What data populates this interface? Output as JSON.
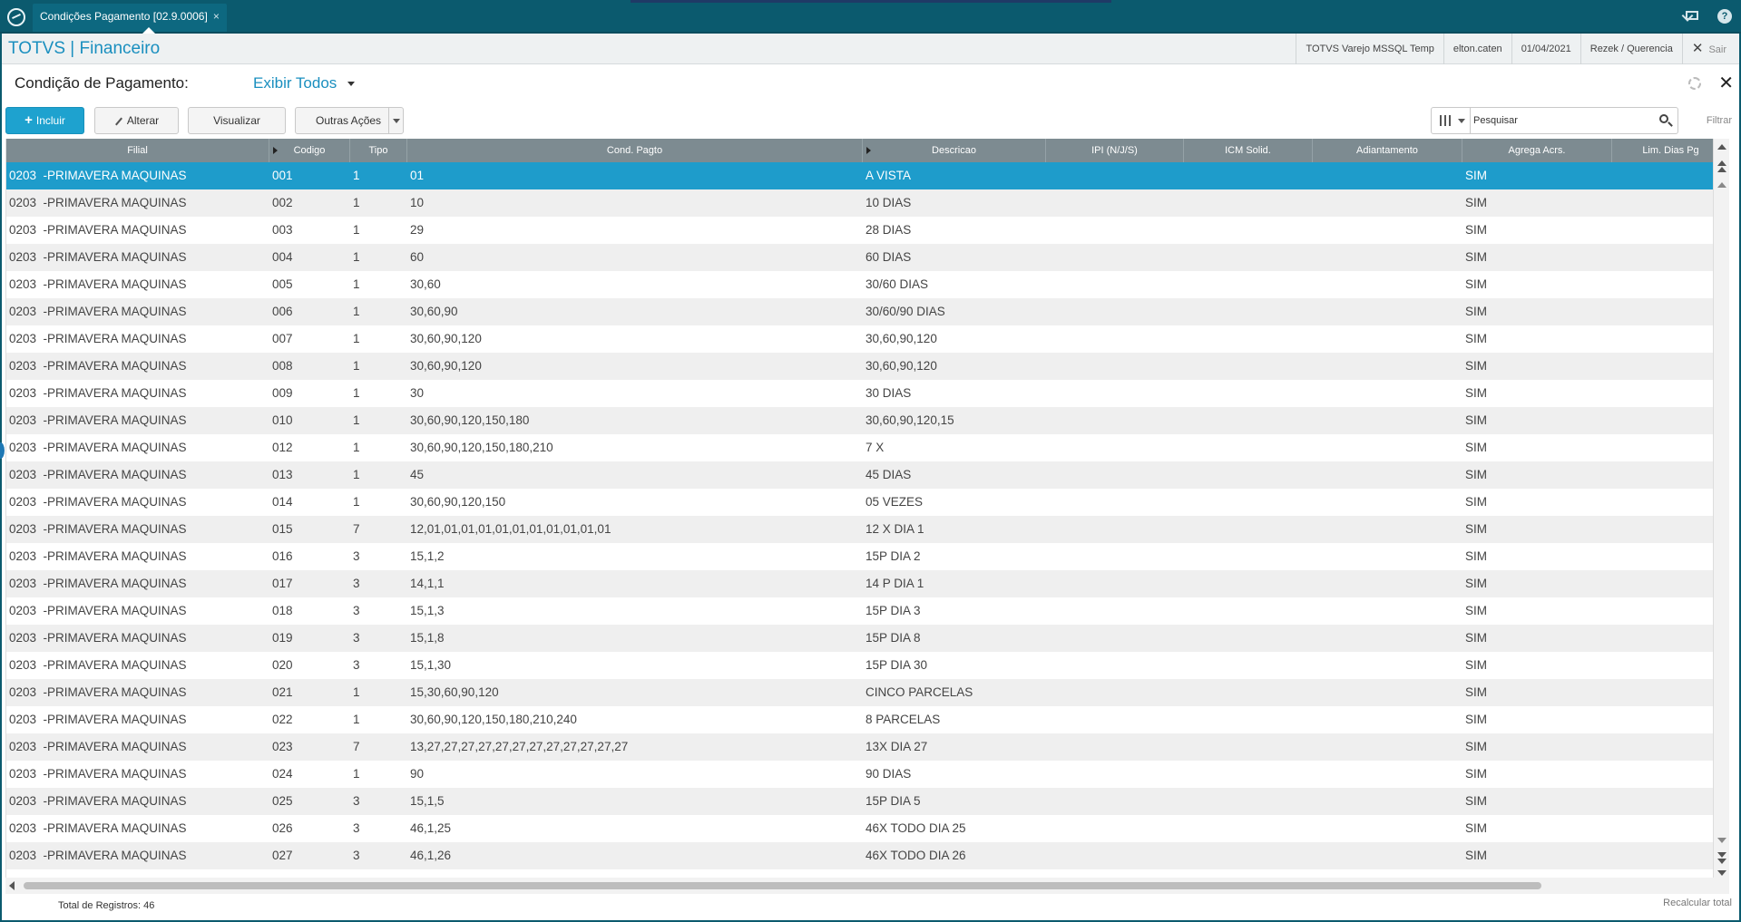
{
  "window": {
    "tab_title": "Condições Pagamento [02.9.0006]",
    "tab_close": "×"
  },
  "module": {
    "title": "TOTVS | Financeiro",
    "environment": "TOTVS Varejo MSSQL Temp",
    "user": "elton.caten",
    "date": "01/04/2021",
    "branch": "Rezek / Querencia",
    "exit_label": "Sair"
  },
  "header": {
    "title": "Condição de Pagamento:",
    "filter_view": "Exibir Todos"
  },
  "toolbar": {
    "include_label": "Incluir",
    "alter_label": "Alterar",
    "view_label": "Visualizar",
    "other_label": "Outras Ações",
    "search_placeholder": "Pesquisar",
    "filter_label": "Filtrar"
  },
  "grid": {
    "columns": [
      "Filial",
      "Codigo",
      "Tipo",
      "Cond. Pagto",
      "Descricao",
      "IPI (N/J/S)",
      "ICM Solid.",
      "Adiantamento",
      "Agrega Acrs.",
      "Lim. Dias Pg"
    ],
    "rows": [
      [
        "0203  -PRIMAVERA MAQUINAS",
        "001",
        "1",
        "01",
        "A VISTA",
        "SIM"
      ],
      [
        "0203  -PRIMAVERA MAQUINAS",
        "002",
        "1",
        "10",
        "10 DIAS",
        "SIM"
      ],
      [
        "0203  -PRIMAVERA MAQUINAS",
        "003",
        "1",
        "29",
        "28 DIAS",
        "SIM"
      ],
      [
        "0203  -PRIMAVERA MAQUINAS",
        "004",
        "1",
        "60",
        "60 DIAS",
        "SIM"
      ],
      [
        "0203  -PRIMAVERA MAQUINAS",
        "005",
        "1",
        "30,60",
        "30/60 DIAS",
        "SIM"
      ],
      [
        "0203  -PRIMAVERA MAQUINAS",
        "006",
        "1",
        "30,60,90",
        "30/60/90 DIAS",
        "SIM"
      ],
      [
        "0203  -PRIMAVERA MAQUINAS",
        "007",
        "1",
        "30,60,90,120",
        "30,60,90,120",
        "SIM"
      ],
      [
        "0203  -PRIMAVERA MAQUINAS",
        "008",
        "1",
        "30,60,90,120",
        "30,60,90,120",
        "SIM"
      ],
      [
        "0203  -PRIMAVERA MAQUINAS",
        "009",
        "1",
        "30",
        "30 DIAS",
        "SIM"
      ],
      [
        "0203  -PRIMAVERA MAQUINAS",
        "010",
        "1",
        "30,60,90,120,150,180",
        "30,60,90,120,15",
        "SIM"
      ],
      [
        "0203  -PRIMAVERA MAQUINAS",
        "012",
        "1",
        "30,60,90,120,150,180,210",
        "7 X",
        "SIM"
      ],
      [
        "0203  -PRIMAVERA MAQUINAS",
        "013",
        "1",
        "45",
        "45 DIAS",
        "SIM"
      ],
      [
        "0203  -PRIMAVERA MAQUINAS",
        "014",
        "1",
        "30,60,90,120,150",
        "05 VEZES",
        "SIM"
      ],
      [
        "0203  -PRIMAVERA MAQUINAS",
        "015",
        "7",
        "12,01,01,01,01,01,01,01,01,01,01,01",
        "12 X DIA 1",
        "SIM"
      ],
      [
        "0203  -PRIMAVERA MAQUINAS",
        "016",
        "3",
        "15,1,2",
        "15P DIA 2",
        "SIM"
      ],
      [
        "0203  -PRIMAVERA MAQUINAS",
        "017",
        "3",
        "14,1,1",
        "14 P DIA 1",
        "SIM"
      ],
      [
        "0203  -PRIMAVERA MAQUINAS",
        "018",
        "3",
        "15,1,3",
        "15P DIA 3",
        "SIM"
      ],
      [
        "0203  -PRIMAVERA MAQUINAS",
        "019",
        "3",
        "15,1,8",
        "15P DIA 8",
        "SIM"
      ],
      [
        "0203  -PRIMAVERA MAQUINAS",
        "020",
        "3",
        "15,1,30",
        "15P DIA 30",
        "SIM"
      ],
      [
        "0203  -PRIMAVERA MAQUINAS",
        "021",
        "1",
        "15,30,60,90,120",
        "CINCO PARCELAS",
        "SIM"
      ],
      [
        "0203  -PRIMAVERA MAQUINAS",
        "022",
        "1",
        "30,60,90,120,150,180,210,240",
        "8 PARCELAS",
        "SIM"
      ],
      [
        "0203  -PRIMAVERA MAQUINAS",
        "023",
        "7",
        "13,27,27,27,27,27,27,27,27,27,27,27,27",
        "13X DIA 27",
        "SIM"
      ],
      [
        "0203  -PRIMAVERA MAQUINAS",
        "024",
        "1",
        "90",
        "90 DIAS",
        "SIM"
      ],
      [
        "0203  -PRIMAVERA MAQUINAS",
        "025",
        "3",
        "15,1,5",
        "15P DIA 5",
        "SIM"
      ],
      [
        "0203  -PRIMAVERA MAQUINAS",
        "026",
        "3",
        "46,1,25",
        "46X TODO DIA 25",
        "SIM"
      ],
      [
        "0203  -PRIMAVERA MAQUINAS",
        "027",
        "3",
        "46,1,26",
        "46X TODO DIA 26",
        "SIM"
      ]
    ]
  },
  "footer": {
    "total_label": "Total de Registros: 46",
    "recalc_label": "Recalcular total"
  },
  "colors": {
    "topbar": "#0b5a6e",
    "accent": "#1a8fbf",
    "selected_row": "#1e9ccb",
    "header_bg": "#7d8b91"
  }
}
